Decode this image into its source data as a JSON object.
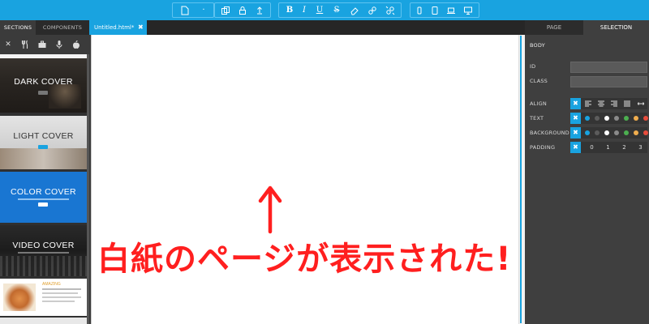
{
  "toolbar": {
    "groups": [
      {
        "name": "file",
        "buttons": [
          "page-icon",
          "dash-icon"
        ]
      },
      {
        "name": "edit",
        "buttons": [
          "copy-icon",
          "lock-icon",
          "export-icon"
        ]
      },
      {
        "name": "format",
        "buttons": [
          "B",
          "I",
          "U",
          "S",
          "eraser-icon",
          "link-icon",
          "unlink-icon"
        ]
      },
      {
        "name": "devices",
        "buttons": [
          "phone-icon",
          "tablet-icon",
          "laptop-icon",
          "desktop-icon"
        ]
      }
    ],
    "format_bold": "B",
    "format_italic": "I",
    "format_underline": "U",
    "format_strike": "S",
    "accent_color": "#19a3e0"
  },
  "left_panel": {
    "tabs": {
      "sections": "SECTIONS",
      "components": "COMPONENTS"
    },
    "filter_icons": [
      "close-icon",
      "cutlery-icon",
      "briefcase-icon",
      "microphone-icon",
      "apple-icon"
    ],
    "close_glyph": "✕",
    "thumbnails": {
      "dark_cover": {
        "title": "DARK COVER"
      },
      "light_cover": {
        "title": "LIGHT COVER"
      },
      "color_cover": {
        "title": "COLOR COVER"
      },
      "video_cover": {
        "title": "VIDEO COVER"
      },
      "food": {
        "title": "AMAZING"
      }
    }
  },
  "editor": {
    "tab_label": "Untitled.html*",
    "tab_close": "✖"
  },
  "right_panel": {
    "tabs": {
      "page": "PAGE",
      "selection": "SELECTION"
    },
    "element": "BODY",
    "id_label": "ID",
    "class_label": "CLASS",
    "align_label": "ALIGN",
    "text_label": "TEXT",
    "background_label": "BACKGROUND",
    "padding_label": "PADDING",
    "reset_glyph": "✖",
    "padding_values": [
      "0",
      "1",
      "2",
      "3"
    ],
    "text_colors": [
      "#19a3e0",
      "#5c5c5c",
      "#ffffff",
      "#8a8a8a",
      "#4caf50",
      "#f0ad4e",
      "#e74c3c"
    ],
    "background_colors": [
      "#19a3e0",
      "#5c5c5c",
      "#ffffff",
      "#8a8a8a",
      "#4caf50",
      "#f0ad4e",
      "#e74c3c"
    ]
  },
  "annotation": {
    "arrow": "↑",
    "text": "白紙のページが表示された!"
  }
}
